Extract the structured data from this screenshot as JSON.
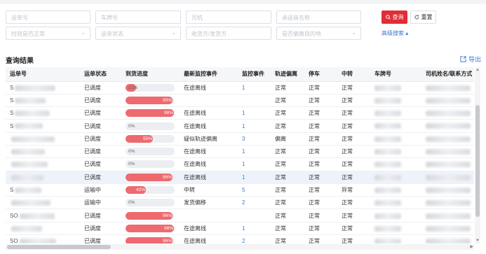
{
  "filters": {
    "row1": [
      "运单号",
      "车牌号",
      "司机",
      "承运商名称"
    ],
    "row2": [
      "时效是否正常",
      "运单状态",
      "收货方/发货方",
      "是否偏离目的地"
    ]
  },
  "buttons": {
    "query": "查询",
    "reset": "重置",
    "advanced": "高级搜索 ▴"
  },
  "section": {
    "title": "查询结果",
    "export": "导出"
  },
  "table": {
    "headers": [
      "运单号",
      "运单状态",
      "到货进度",
      "最新监控事件",
      "监控事件",
      "轨迹偏离",
      "停车",
      "中转",
      "车牌号",
      "司机姓名/联系方式"
    ],
    "rows": [
      {
        "waybill": "S",
        "status": "已调度",
        "progress": 21,
        "event": "在途离线",
        "count": "1",
        "deviate": "正常",
        "park": "正常",
        "transfer": "正常",
        "plate": "",
        "driver": ""
      },
      {
        "waybill": "S",
        "status": "已调度",
        "progress": 95,
        "event": "",
        "count": "",
        "deviate": "正常",
        "park": "正常",
        "transfer": "正常",
        "plate": "",
        "driver": ""
      },
      {
        "waybill": "S",
        "status": "已调度",
        "progress": 98,
        "event": "在途离线",
        "count": "1",
        "deviate": "正常",
        "park": "正常",
        "transfer": "正常",
        "plate": "",
        "driver": ""
      },
      {
        "waybill": "S",
        "status": "已调度",
        "progress": 0,
        "event": "在途离线",
        "count": "1",
        "deviate": "正常",
        "park": "正常",
        "transfer": "正常",
        "plate": "",
        "driver": ""
      },
      {
        "waybill": "",
        "status": "已调度",
        "progress": 55,
        "event": "疑似轨迹偏离",
        "count": "3",
        "deviate": "偏离",
        "park": "正常",
        "transfer": "正常",
        "plate": "",
        "driver": ""
      },
      {
        "waybill": "",
        "status": "已调度",
        "progress": 0,
        "event": "在途离线",
        "count": "1",
        "deviate": "正常",
        "park": "正常",
        "transfer": "正常",
        "plate": "",
        "driver": ""
      },
      {
        "waybill": "",
        "status": "已调度",
        "progress": 0,
        "event": "在途离线",
        "count": "1",
        "deviate": "正常",
        "park": "正常",
        "transfer": "正常",
        "plate": "",
        "driver": ""
      },
      {
        "waybill": "",
        "status": "已调度",
        "progress": 96,
        "event": "在途离线",
        "count": "1",
        "deviate": "正常",
        "park": "正常",
        "transfer": "正常",
        "plate": "",
        "driver": ""
      },
      {
        "waybill": "S",
        "status": "运输中",
        "progress": 42,
        "event": "中转",
        "count": "5",
        "deviate": "正常",
        "park": "正常",
        "transfer": "异常",
        "plate": "",
        "driver": ""
      },
      {
        "waybill": "",
        "status": "运输中",
        "progress": 0,
        "event": "发货偏移",
        "count": "2",
        "deviate": "正常",
        "park": "正常",
        "transfer": "正常",
        "plate": "",
        "driver": ""
      },
      {
        "waybill": "SO",
        "status": "已调度",
        "progress": 96,
        "event": "",
        "count": "",
        "deviate": "正常",
        "park": "正常",
        "transfer": "正常",
        "plate": "",
        "driver": ""
      },
      {
        "waybill": "",
        "status": "已调度",
        "progress": 98,
        "event": "在途离线",
        "count": "1",
        "deviate": "正常",
        "park": "正常",
        "transfer": "正常",
        "plate": "",
        "driver": ""
      },
      {
        "waybill": "SO",
        "status": "已调度",
        "progress": 96,
        "event": "在途离线",
        "count": "2",
        "deviate": "正常",
        "park": "正常",
        "transfer": "正常",
        "plate": "",
        "driver": ""
      }
    ]
  },
  "colors": {
    "accent": "#e02e37",
    "link": "#3f78d8",
    "progress": "#ed6a6f"
  }
}
